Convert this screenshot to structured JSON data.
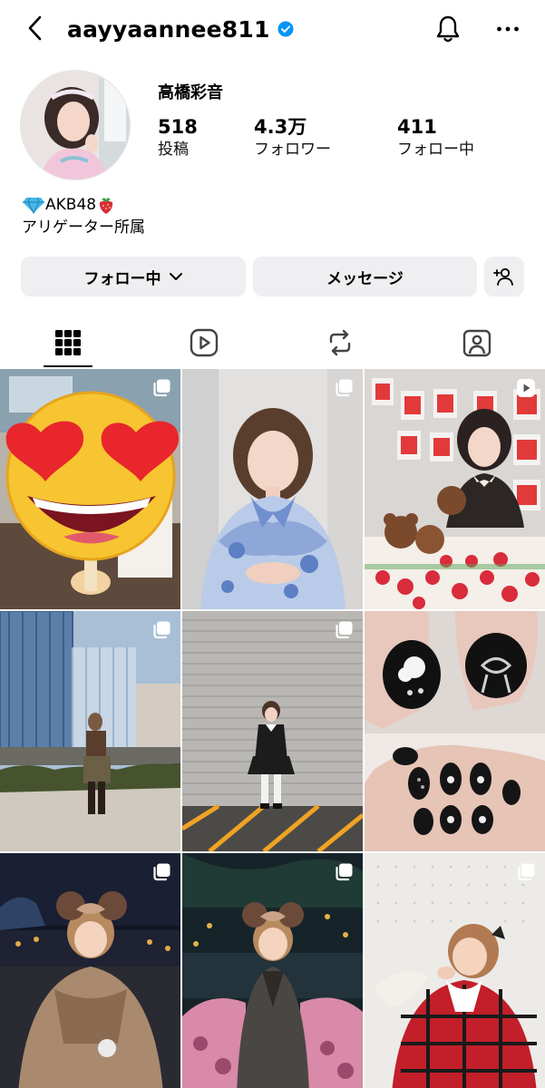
{
  "header": {
    "username": "aayyaannee811",
    "icons": [
      "chevron-left-icon",
      "verified-badge-icon",
      "bell-icon",
      "more-horizontal-icon"
    ]
  },
  "profile": {
    "display_name": "高橋彩音",
    "stats": [
      {
        "value": "518",
        "label": "投稿"
      },
      {
        "value": "4.3万",
        "label": "フォロワー"
      },
      {
        "value": "411",
        "label": "フォロー中"
      }
    ],
    "bio": {
      "line1_text": "AKB48",
      "line1_prefix_emoji": "💎",
      "line1_suffix_emoji": "🍓",
      "line2": "アリゲーター所属"
    }
  },
  "actions": {
    "following_label": "フォロー中",
    "message_label": "メッセージ",
    "add_user_icon": "add-user-icon"
  },
  "tabs": [
    {
      "name": "grid",
      "icon": "grid-icon",
      "active": true
    },
    {
      "name": "reels",
      "icon": "reels-icon",
      "active": false
    },
    {
      "name": "reposts",
      "icon": "repost-icon",
      "active": false
    },
    {
      "name": "tagged",
      "icon": "tagged-icon",
      "active": false
    }
  ],
  "posts": [
    {
      "type": "carousel"
    },
    {
      "type": "carousel"
    },
    {
      "type": "reel"
    },
    {
      "type": "carousel"
    },
    {
      "type": "carousel"
    },
    {
      "type": "none"
    },
    {
      "type": "carousel"
    },
    {
      "type": "carousel"
    },
    {
      "type": "carousel"
    }
  ],
  "colors": {
    "button_bg": "#efeff2",
    "verified_blue": "#0095f6",
    "text": "#000000"
  }
}
